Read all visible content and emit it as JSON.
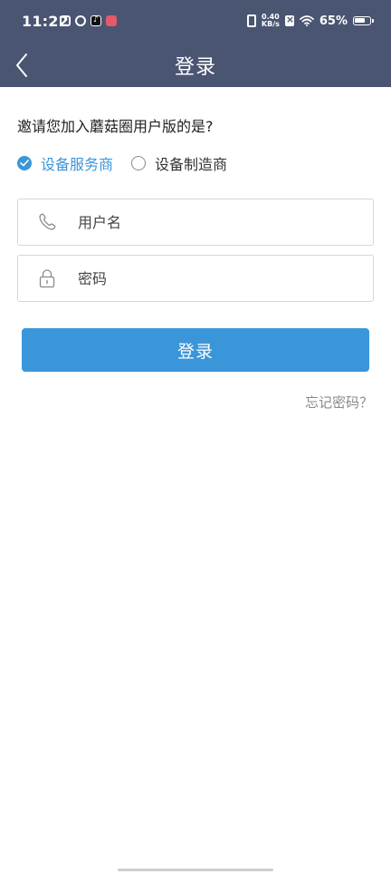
{
  "status_bar": {
    "time": "11:22",
    "net_speed_value": "0.40",
    "net_speed_unit": "KB/s",
    "battery_percent": "65%",
    "left_icons": [
      "calendar-icon",
      "swirl-icon",
      "tiktok-icon",
      "app-notification-icon"
    ],
    "right_icons": [
      "vibrate-icon",
      "no-sim-icon",
      "wifi-icon",
      "battery-icon"
    ]
  },
  "header": {
    "title": "登录",
    "back_icon": "chevron-left-icon"
  },
  "form": {
    "question": "邀请您加入蘑菇圈用户版的是?",
    "roles": [
      {
        "label": "设备服务商",
        "selected": true
      },
      {
        "label": "设备制造商",
        "selected": false
      }
    ],
    "username": {
      "placeholder": "用户名",
      "value": "",
      "icon": "phone-icon"
    },
    "password": {
      "placeholder": "密码",
      "value": "",
      "icon": "lock-icon"
    },
    "login_label": "登录",
    "forgot_label": "忘记密码？"
  },
  "colors": {
    "header_bg": "#4a5572",
    "accent": "#3a96d8",
    "border": "#d6d6d6",
    "muted_text": "#8a8a8a"
  }
}
